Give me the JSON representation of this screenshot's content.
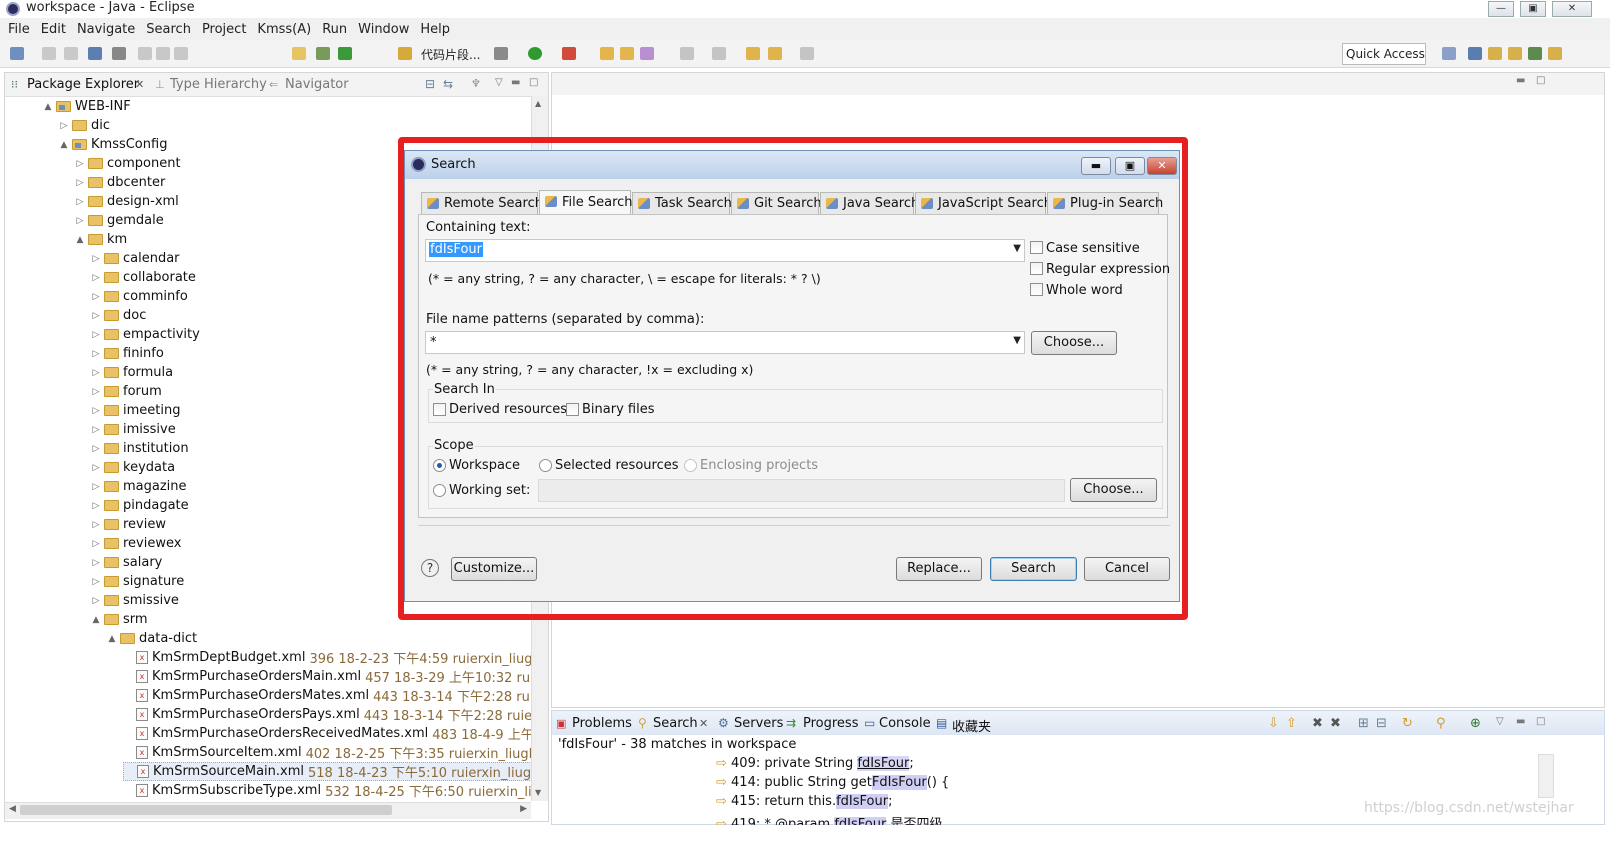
{
  "window": {
    "title": "workspace - Java - Eclipse"
  },
  "menu": [
    "File",
    "Edit",
    "Navigate",
    "Search",
    "Project",
    "Kmss(A)",
    "Run",
    "Window",
    "Help"
  ],
  "toolbar": {
    "snippet_label": "代码片段...",
    "quick_access": "Quick Access"
  },
  "package_explorer": {
    "tabs": [
      "Package Explorer",
      "Type Hierarchy",
      "Navigator"
    ],
    "tree": [
      {
        "indent": 0,
        "twisty": "▲",
        "icon": "pkg",
        "label": "WEB-INF"
      },
      {
        "indent": 1,
        "twisty": "▷",
        "icon": "fold",
        "label": "dic"
      },
      {
        "indent": 1,
        "twisty": "▲",
        "icon": "pkg",
        "label": "KmssConfig"
      },
      {
        "indent": 2,
        "twisty": "▷",
        "icon": "fold",
        "label": "component"
      },
      {
        "indent": 2,
        "twisty": "▷",
        "icon": "fold",
        "label": "dbcenter"
      },
      {
        "indent": 2,
        "twisty": "▷",
        "icon": "fold",
        "label": "design-xml"
      },
      {
        "indent": 2,
        "twisty": "▷",
        "icon": "fold",
        "label": "gemdale"
      },
      {
        "indent": 2,
        "twisty": "▲",
        "icon": "fold",
        "label": "km"
      },
      {
        "indent": 3,
        "twisty": "▷",
        "icon": "fold",
        "label": "calendar"
      },
      {
        "indent": 3,
        "twisty": "▷",
        "icon": "fold",
        "label": "collaborate"
      },
      {
        "indent": 3,
        "twisty": "▷",
        "icon": "fold",
        "label": "comminfo"
      },
      {
        "indent": 3,
        "twisty": "▷",
        "icon": "fold",
        "label": "doc"
      },
      {
        "indent": 3,
        "twisty": "▷",
        "icon": "fold",
        "label": "empactivity"
      },
      {
        "indent": 3,
        "twisty": "▷",
        "icon": "fold",
        "label": "fininfo"
      },
      {
        "indent": 3,
        "twisty": "▷",
        "icon": "fold",
        "label": "formula"
      },
      {
        "indent": 3,
        "twisty": "▷",
        "icon": "fold",
        "label": "forum"
      },
      {
        "indent": 3,
        "twisty": "▷",
        "icon": "fold",
        "label": "imeeting"
      },
      {
        "indent": 3,
        "twisty": "▷",
        "icon": "fold",
        "label": "imissive"
      },
      {
        "indent": 3,
        "twisty": "▷",
        "icon": "fold",
        "label": "institution"
      },
      {
        "indent": 3,
        "twisty": "▷",
        "icon": "fold",
        "label": "keydata"
      },
      {
        "indent": 3,
        "twisty": "▷",
        "icon": "fold",
        "label": "magazine"
      },
      {
        "indent": 3,
        "twisty": "▷",
        "icon": "fold",
        "label": "pindagate"
      },
      {
        "indent": 3,
        "twisty": "▷",
        "icon": "fold",
        "label": "review"
      },
      {
        "indent": 3,
        "twisty": "▷",
        "icon": "fold",
        "label": "reviewex"
      },
      {
        "indent": 3,
        "twisty": "▷",
        "icon": "fold",
        "label": "salary"
      },
      {
        "indent": 3,
        "twisty": "▷",
        "icon": "fold",
        "label": "signature"
      },
      {
        "indent": 3,
        "twisty": "▷",
        "icon": "fold",
        "label": "smissive"
      },
      {
        "indent": 3,
        "twisty": "▲",
        "icon": "fold",
        "label": "srm"
      },
      {
        "indent": 4,
        "twisty": "▲",
        "icon": "fold",
        "label": "data-dict"
      },
      {
        "indent": 5,
        "twisty": "",
        "icon": "xml",
        "label": "KmSrmDeptBudget.xml",
        "meta": "396  18-2-23 下午4:59  ruierxin_liugl"
      },
      {
        "indent": 5,
        "twisty": "",
        "icon": "xml",
        "label": "KmSrmPurchaseOrdersMain.xml",
        "meta": "457  18-3-29 上午10:32  ruierxi"
      },
      {
        "indent": 5,
        "twisty": "",
        "icon": "xml",
        "label": "KmSrmPurchaseOrdersMates.xml",
        "meta": "443  18-3-14 下午2:28  ruierxi"
      },
      {
        "indent": 5,
        "twisty": "",
        "icon": "xml",
        "label": "KmSrmPurchaseOrdersPays.xml",
        "meta": "443  18-3-14 下午2:28  ruierxin"
      },
      {
        "indent": 5,
        "twisty": "",
        "icon": "xml",
        "label": "KmSrmPurchaseOrdersReceivedMates.xml",
        "meta": "483  18-4-9 上午10:"
      },
      {
        "indent": 5,
        "twisty": "",
        "icon": "xml",
        "label": "KmSrmSourceItem.xml",
        "meta": "402  18-2-25 下午3:35  ruierxin_liugl"
      },
      {
        "indent": 5,
        "twisty": "",
        "icon": "xml",
        "label": "KmSrmSourceMain.xml",
        "meta": "518  18-4-23 下午5:10  ruierxin_liugl",
        "selected": true
      },
      {
        "indent": 5,
        "twisty": "",
        "icon": "xml",
        "label": "KmSrmSubscribeType.xml",
        "meta": "532  18-4-25 下午6:50  ruierxin_liugl"
      }
    ]
  },
  "dialog": {
    "title": "Search",
    "tabs": [
      "Remote Search",
      "File Search",
      "Task Search",
      "Git Search",
      "Java Search",
      "JavaScript Search",
      "Plug-in Search"
    ],
    "containing_text_label": "Containing text:",
    "containing_text_value": "fdIsFour",
    "containing_hint": "(* = any string, ? = any character, \\ = escape for literals: * ? \\)",
    "case_sensitive": "Case sensitive",
    "regular_expression": "Regular expression",
    "whole_word": "Whole word",
    "file_patterns_label": "File name patterns (separated by comma):",
    "file_patterns_value": "*",
    "choose_label": "Choose...",
    "patterns_hint": "(* = any string, ? = any character, !x = excluding x)",
    "search_in_label": "Search In",
    "derived_resources": "Derived resources",
    "binary_files": "Binary files",
    "scope_label": "Scope",
    "workspace": "Workspace",
    "selected_resources": "Selected resources",
    "enclosing_projects": "Enclosing projects",
    "working_set": "Working set:",
    "customize": "Customize...",
    "replace": "Replace...",
    "search": "Search",
    "cancel": "Cancel"
  },
  "bottom": {
    "tabs": [
      "Problems",
      "Search",
      "Servers",
      "Progress",
      "Console",
      "收藏夹"
    ],
    "summary": "'fdIsFour' - 38 matches in workspace",
    "results": [
      {
        "pre": "409: private String ",
        "match": "fdIsFour",
        "post": ";"
      },
      {
        "pre": "414: public String get",
        "match": "FdIsFour",
        "post": "() {"
      },
      {
        "pre": "415: return this.",
        "match": "fdIsFour",
        "post": ";"
      },
      {
        "pre": "419: * @param ",
        "match": "fdIsFour",
        "post": " 是否四级"
      }
    ]
  },
  "watermark": "https://blog.csdn.net/wstejhar",
  "colors": {
    "highlight_frame": "#e62020",
    "selection": "#3399ff"
  }
}
